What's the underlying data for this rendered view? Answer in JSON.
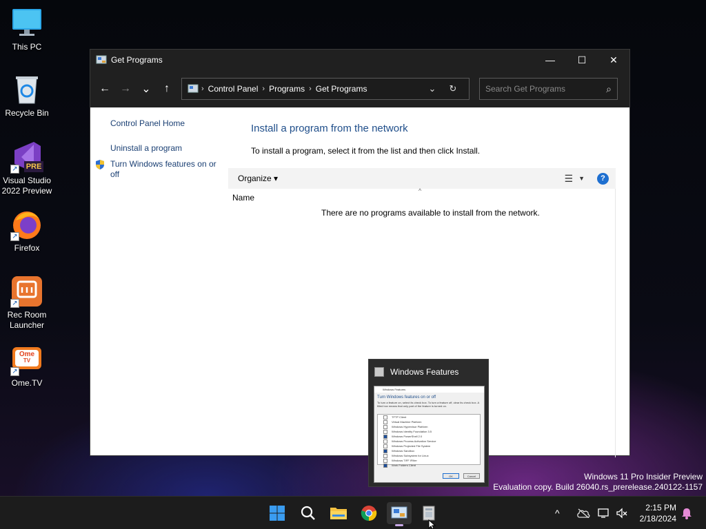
{
  "desktop": {
    "icons": [
      {
        "label": "This PC"
      },
      {
        "label": "Recycle Bin"
      },
      {
        "label": "Visual Studio 2022 Preview",
        "badge": "PRE"
      },
      {
        "label": "Firefox"
      },
      {
        "label": "Rec Room Launcher"
      },
      {
        "label": "Ome.TV",
        "logo": "Ome",
        "logo_sub": "TV"
      }
    ]
  },
  "window": {
    "title": "Get Programs",
    "controls": {
      "minimize": "—",
      "maximize": "☐",
      "close": "✕"
    },
    "nav": {
      "back": "←",
      "forward": "→",
      "recent": "⌄",
      "up": "↑"
    },
    "address": {
      "crumbs": [
        "Control Panel",
        "Programs",
        "Get Programs"
      ],
      "separator": "›",
      "dropdown": "⌄",
      "refresh": "↻"
    },
    "search": {
      "placeholder": "Search Get Programs",
      "icon": "⌕"
    },
    "left_pane": {
      "links": [
        "Control Panel Home",
        "Uninstall a program",
        "Turn Windows features on or off"
      ]
    },
    "main": {
      "heading": "Install a program from the network",
      "description": "To install a program, select it from the list and then click Install.",
      "toolbar": {
        "organize": "Organize ▾",
        "view": "☰",
        "view_caret": "▼",
        "help": "?"
      },
      "column": "Name",
      "sort_caret": "^",
      "empty_message": "There are no programs available to install from the network."
    }
  },
  "thumbnail": {
    "title": "Windows Features",
    "preview": {
      "window_title": "Windows Features",
      "heading": "Turn Windows features on or off",
      "description": "To turn a feature on, select its check box. To turn a feature off, clear its check box. A filled box means that only part of the feature is turned on.",
      "items": [
        {
          "label": "TFTP Client",
          "on": false
        },
        {
          "label": "Virtual Machine Platform",
          "on": false
        },
        {
          "label": "Windows Hypervisor Platform",
          "on": false
        },
        {
          "label": "Windows Identity Foundation 3.5",
          "on": false
        },
        {
          "label": "Windows PowerShell 2.0",
          "on": true
        },
        {
          "label": "Windows Process Activation Service",
          "on": false
        },
        {
          "label": "Windows Projected File System",
          "on": false
        },
        {
          "label": "Windows Sandbox",
          "on": true
        },
        {
          "label": "Windows Subsystem for Linux",
          "on": false
        },
        {
          "label": "Windows TIFF IFilter",
          "on": false
        },
        {
          "label": "Work Folders Client",
          "on": true
        }
      ],
      "ok": "OK",
      "cancel": "Cancel"
    }
  },
  "watermark": {
    "line1": "Windows 11 Pro Insider Preview",
    "line2": "Evaluation copy. Build 26040.rs_prerelease.240122-1157"
  },
  "taskbar": {
    "clock": {
      "time": "2:15 PM",
      "date": "2/18/2024"
    },
    "tray_chevron": "^"
  },
  "colors": {
    "accent": "#1e6fd0",
    "link": "#1a3f73",
    "heading": "#1f4e8a"
  }
}
